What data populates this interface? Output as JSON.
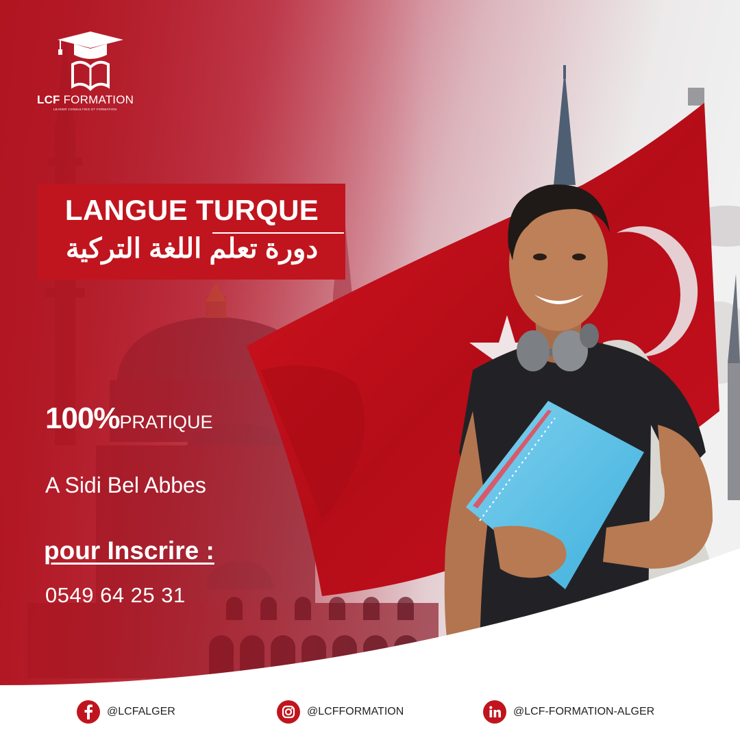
{
  "brand": {
    "name_bold": "LCF",
    "name_light": "FORMATION",
    "tagline": "LEADER CONSULTING ET FORMATION"
  },
  "headline": {
    "fr": "LANGUE TURQUE",
    "ar": "دورة تعلم اللغة التركية"
  },
  "practice": {
    "percent": "100%",
    "label": "PRATIQUE"
  },
  "location": "A Sidi Bel Abbes",
  "signup": {
    "label": "pour Inscrire :",
    "phone": "0549 64 25 31"
  },
  "social": [
    {
      "icon": "facebook-icon",
      "handle": "@LCFALGER"
    },
    {
      "icon": "instagram-icon",
      "handle": "@LCFFORMATION"
    },
    {
      "icon": "linkedin-icon",
      "handle": "@LCF-FORMATION-ALGER"
    }
  ],
  "colors": {
    "brand_red": "#c0151e",
    "flag_red": "#c8101e",
    "text_dark": "#222222",
    "white": "#ffffff"
  }
}
